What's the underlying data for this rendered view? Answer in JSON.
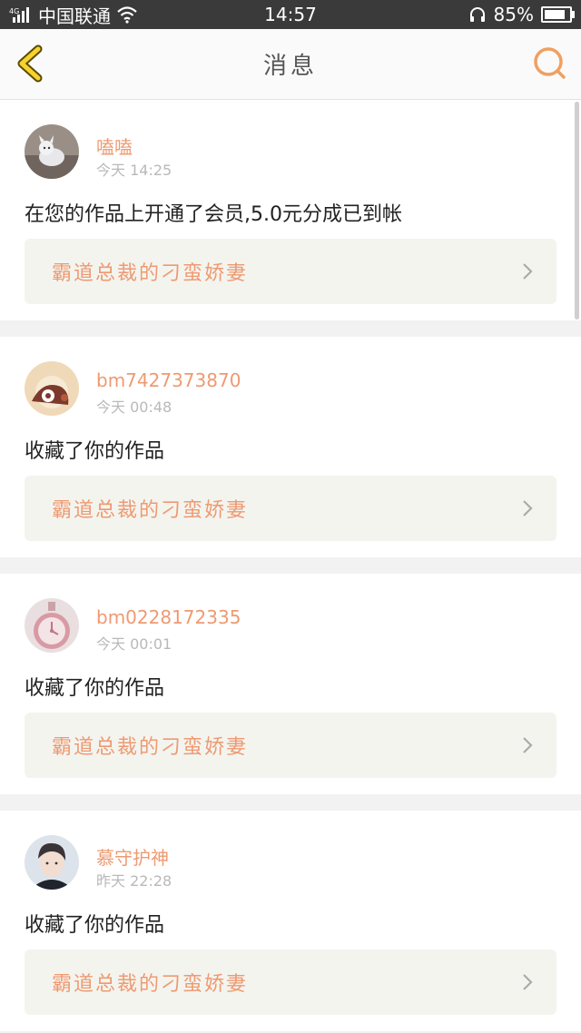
{
  "status_bar": {
    "network": "4G",
    "carrier": "中国联通",
    "time": "14:57",
    "battery": "85%",
    "battery_level": 0.85
  },
  "nav": {
    "title": "消息",
    "back_icon": "chevron-left-icon",
    "search_icon": "search-icon",
    "accent_color": "#f0a060"
  },
  "messages": [
    {
      "username": "嗑嗑",
      "time": "今天 14:25",
      "text": "在您的作品上开通了会员,5.0元分成已到帐",
      "work_title": "霸道总裁的刁蛮娇妻"
    },
    {
      "username": "bm7427373870",
      "time": "今天 00:48",
      "text": "收藏了你的作品",
      "work_title": "霸道总裁的刁蛮娇妻"
    },
    {
      "username": "bm0228172335",
      "time": "今天 00:01",
      "text": "收藏了你的作品",
      "work_title": "霸道总裁的刁蛮娇妻"
    },
    {
      "username": "慕守护神",
      "time": "昨天 22:28",
      "text": "收藏了你的作品",
      "work_title": "霸道总裁的刁蛮娇妻"
    }
  ]
}
